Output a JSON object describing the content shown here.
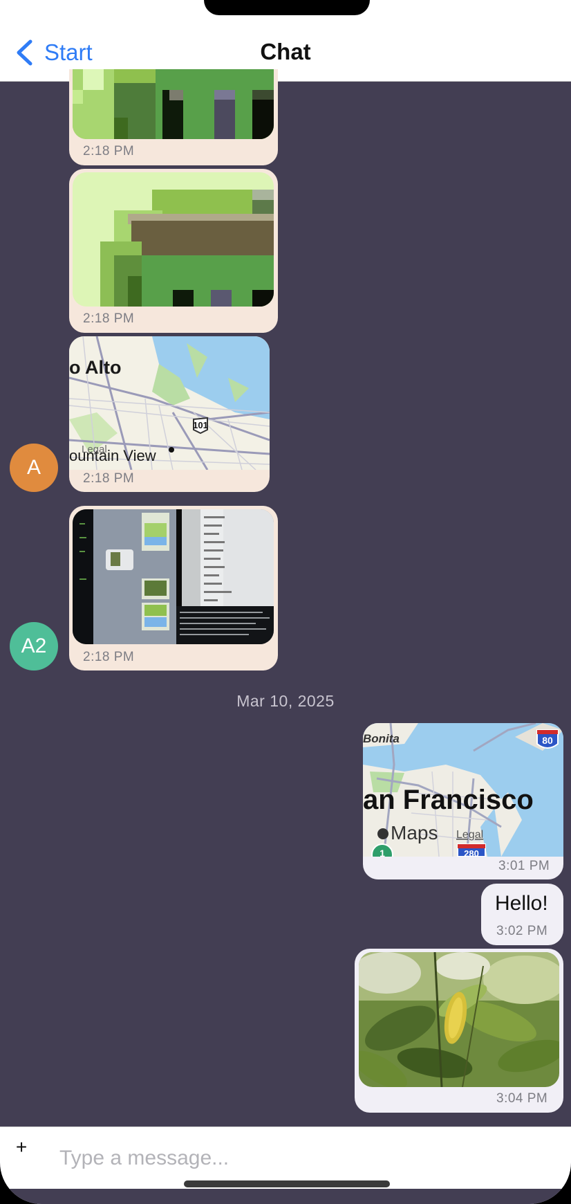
{
  "header": {
    "back_label": "Start",
    "title": "Chat"
  },
  "messages": [
    {
      "sender": "",
      "kind": "image",
      "content": "pixel-art-green",
      "time": "2:18 PM"
    },
    {
      "sender": "",
      "kind": "image",
      "content": "pixel-art-green-brown",
      "time": "2:18 PM"
    },
    {
      "sender": "A",
      "kind": "map",
      "content": "map-palo-alto",
      "time": "2:18 PM",
      "map_labels": {
        "city1": "o Alto",
        "city2": "ountain View",
        "legal": "Legal",
        "route": "101"
      }
    },
    {
      "sender": "A2",
      "kind": "image",
      "content": "photo-screen",
      "time": "2:18 PM"
    },
    {
      "sender": "me",
      "kind": "map",
      "content": "map-san-francisco",
      "time": "3:01 PM",
      "map_labels": {
        "city": "an Francisco",
        "area": "Bonita",
        "brand": "Maps",
        "legal": "Legal",
        "i80": "80",
        "i280": "280",
        "one": "1"
      }
    },
    {
      "sender": "me",
      "kind": "text",
      "text": "Hello!",
      "time": "3:02 PM"
    },
    {
      "sender": "me",
      "kind": "image",
      "content": "photo-leaves",
      "time": "3:04 PM"
    }
  ],
  "avatars": [
    {
      "initials": "A",
      "color": "#E08B3E"
    },
    {
      "initials": "A2",
      "color": "#4FBE98"
    }
  ],
  "date_separator": "Mar 10, 2025",
  "composer": {
    "plus_label": "+",
    "placeholder": "Type a message..."
  },
  "colors": {
    "background": "#433E53",
    "incoming_bubble": "#F6E7DC",
    "outgoing_bubble": "#F1EFF6",
    "accent": "#2F7CF6"
  }
}
